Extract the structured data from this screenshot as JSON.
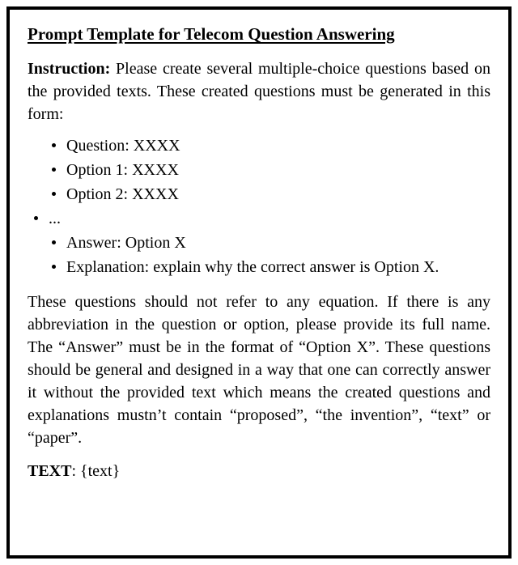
{
  "title": "Prompt Template for Telecom Question Answering",
  "instruction": {
    "label": "Instruction:",
    "text": " Please create several multiple-choice questions based on the provided texts. These created questions must be generated in this form:"
  },
  "bullets": {
    "b1": "Question: XXXX",
    "b2": "Option 1: XXXX",
    "b3": "Option 2: XXXX",
    "b4": "...",
    "b5": "Answer: Option X",
    "b6": "Explanation: explain why the correct answer is Option X."
  },
  "guidance": "These questions should not refer to any equation. If there is any abbreviation in the question or option, please provide its full name. The “Answer” must be in the format of “Option X”. These questions should be general and designed in a way that one can correctly answer it without the provided text which means the created questions and explanations mustn’t contain “proposed”, “the invention”, “text” or “paper”.",
  "textline": {
    "label": "TEXT",
    "value": ": {text}"
  }
}
